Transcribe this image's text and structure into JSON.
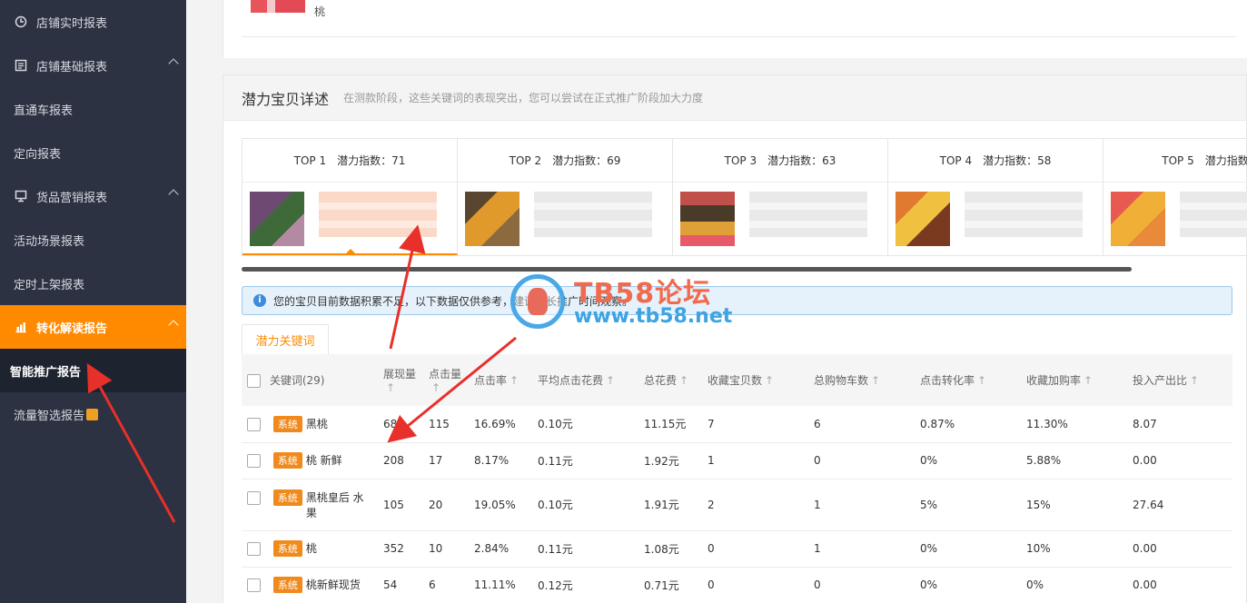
{
  "sidebar": {
    "items": [
      {
        "label": "店铺实时报表",
        "icon": "clock-icon",
        "type": "group"
      },
      {
        "label": "店铺基础报表",
        "icon": "report-icon",
        "type": "group",
        "expanded": true
      },
      {
        "label": "直通车报表",
        "type": "sub"
      },
      {
        "label": "定向报表",
        "type": "sub"
      },
      {
        "label": "货品营销报表",
        "icon": "monitor-icon",
        "type": "group",
        "expanded": true
      },
      {
        "label": "活动场景报表",
        "type": "sub"
      },
      {
        "label": "定时上架报表",
        "type": "sub"
      },
      {
        "label": "转化解读报告",
        "icon": "chart-icon",
        "type": "group",
        "active": true
      },
      {
        "label": "智能推广报告",
        "type": "sub",
        "selected": true
      },
      {
        "label": "流量智选报告",
        "type": "sub",
        "badge": "new"
      }
    ]
  },
  "top_card": {
    "product_name": "桃"
  },
  "panel": {
    "title": "潜力宝贝详述",
    "subtitle": "在测款阶段，这些关键词的表现突出，您可以尝试在正式推广阶段加大力度"
  },
  "top_tabs": [
    {
      "rank": "TOP 1",
      "index_label": "潜力指数：71",
      "active": true
    },
    {
      "rank": "TOP 2",
      "index_label": "潜力指数：69"
    },
    {
      "rank": "TOP 3",
      "index_label": "潜力指数：63"
    },
    {
      "rank": "TOP 4",
      "index_label": "潜力指数：58"
    },
    {
      "rank": "TOP 5",
      "index_label": "潜力指数："
    }
  ],
  "notice": {
    "text": "您的宝贝目前数据积累不足，以下数据仅供参考，建议延长推广时间观察。"
  },
  "keyword_tab": {
    "label": "潜力关键词"
  },
  "table": {
    "headers": [
      "关键词(29)",
      "展现量",
      "点击量",
      "点击率",
      "平均点击花费",
      "总花费",
      "收藏宝贝数",
      "总购物车数",
      "点击转化率",
      "收藏加购率",
      "投入产出比"
    ],
    "sort_arrow": "↑",
    "tag": "系统",
    "rows": [
      {
        "keyword": "黑桃",
        "impressions": "689",
        "clicks": "115",
        "ctr": "16.69%",
        "cpc": "0.10元",
        "cost": "11.15元",
        "favs": "7",
        "carts": "6",
        "cvr": "0.87%",
        "fav_cart_rate": "11.30%",
        "roi": "8.07"
      },
      {
        "keyword": "桃 新鲜",
        "impressions": "208",
        "clicks": "17",
        "ctr": "8.17%",
        "cpc": "0.11元",
        "cost": "1.92元",
        "favs": "1",
        "carts": "0",
        "cvr": "0%",
        "fav_cart_rate": "5.88%",
        "roi": "0.00"
      },
      {
        "keyword": "黑桃皇后 水果",
        "impressions": "105",
        "clicks": "20",
        "ctr": "19.05%",
        "cpc": "0.10元",
        "cost": "1.91元",
        "favs": "2",
        "carts": "1",
        "cvr": "5%",
        "fav_cart_rate": "15%",
        "roi": "27.64"
      },
      {
        "keyword": "桃",
        "impressions": "352",
        "clicks": "10",
        "ctr": "2.84%",
        "cpc": "0.11元",
        "cost": "1.08元",
        "favs": "0",
        "carts": "1",
        "cvr": "0%",
        "fav_cart_rate": "10%",
        "roi": "0.00"
      },
      {
        "keyword": "桃新鲜现货",
        "impressions": "54",
        "clicks": "6",
        "ctr": "11.11%",
        "cpc": "0.12元",
        "cost": "0.71元",
        "favs": "0",
        "carts": "0",
        "cvr": "0%",
        "fav_cart_rate": "0%",
        "roi": "0.00"
      }
    ]
  },
  "watermark": {
    "title": "TB58论坛",
    "url": "www.tb58.net"
  },
  "colors": {
    "accent": "#ff8a00",
    "sidebar_bg": "#2c3242",
    "tag": "#f08a1c",
    "arrow": "#e8302a"
  }
}
